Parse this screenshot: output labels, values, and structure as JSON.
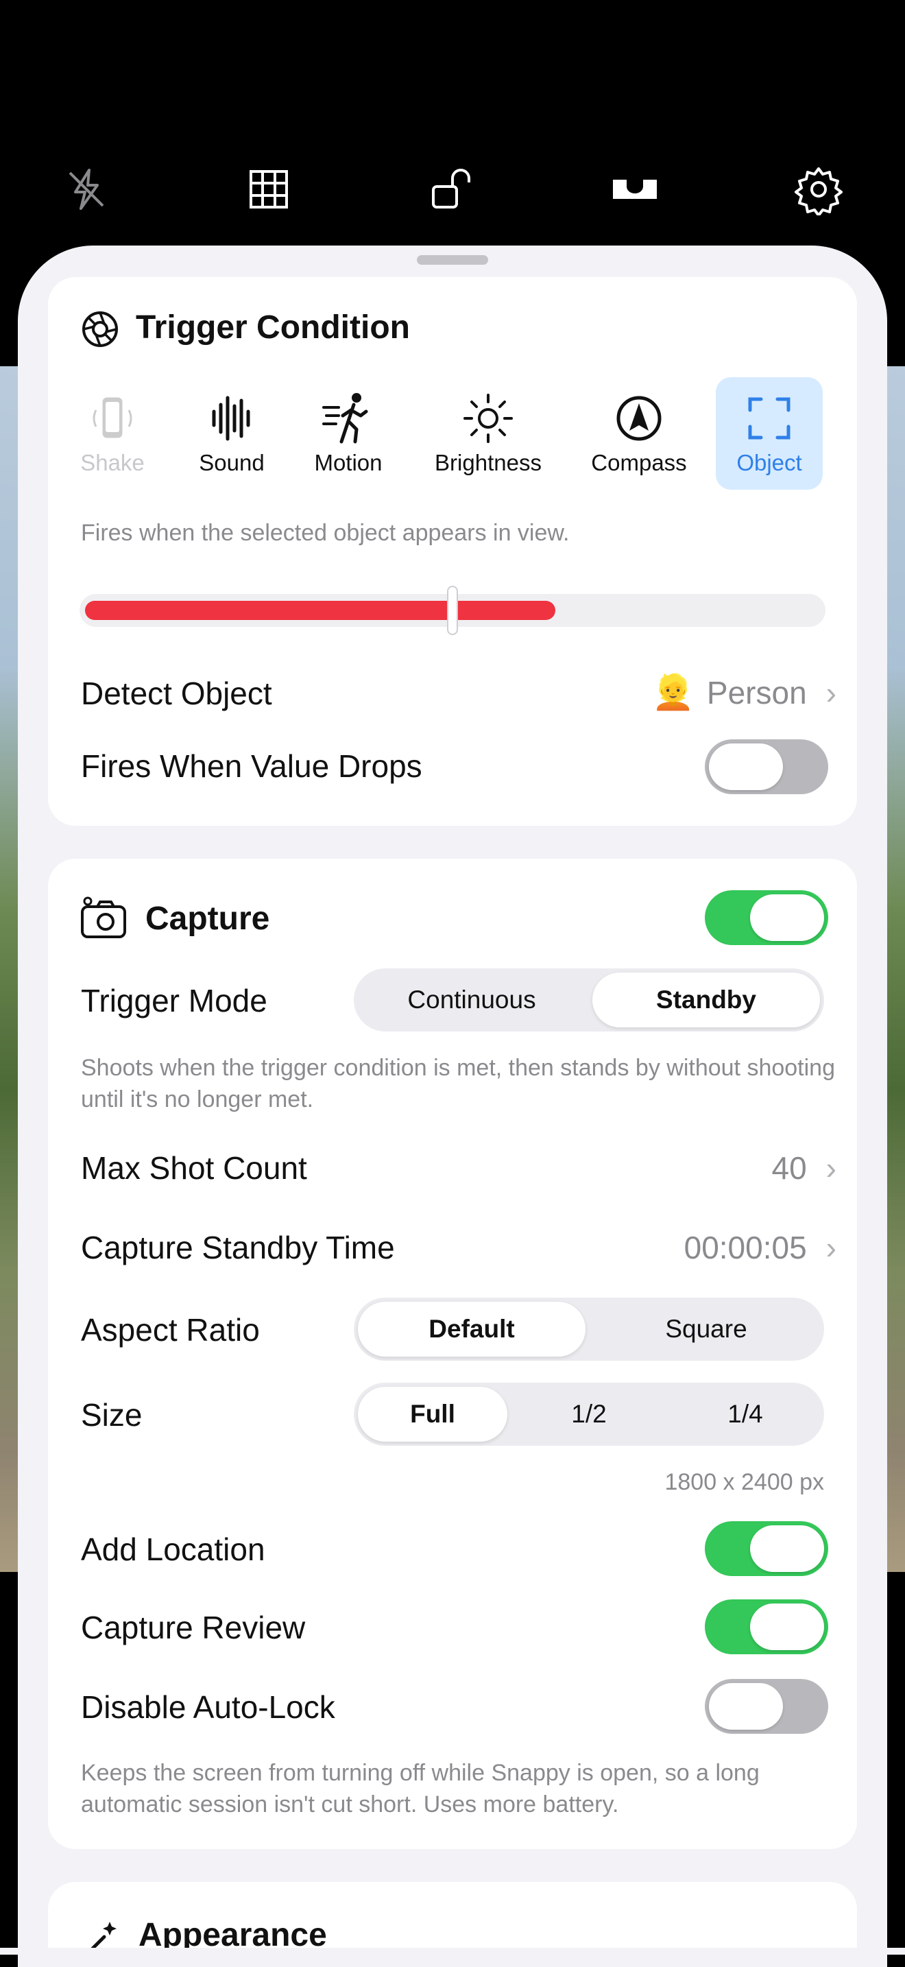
{
  "toolbar": {
    "icons": [
      "flash-off-icon",
      "grid-icon",
      "lock-open-icon",
      "level-icon",
      "gear-icon"
    ]
  },
  "trigger_condition": {
    "title": "Trigger Condition",
    "icon": "aperture-icon",
    "options": [
      {
        "label": "Shake",
        "icon": "phone-shake-icon"
      },
      {
        "label": "Sound",
        "icon": "waveform-icon"
      },
      {
        "label": "Motion",
        "icon": "running-figure-icon"
      },
      {
        "label": "Brightness",
        "icon": "sun-icon"
      },
      {
        "label": "Compass",
        "icon": "compass-icon"
      },
      {
        "label": "Object",
        "icon": "viewfinder-icon"
      }
    ],
    "selected": "Object",
    "description": "Fires when the selected object appears in view.",
    "slider": {
      "fill_fraction": 0.64,
      "thumb_fraction": 0.5
    },
    "detect_object": {
      "label": "Detect Object",
      "emoji": "👱",
      "value": "Person"
    },
    "fires_when_value_drops": {
      "label": "Fires When Value Drops",
      "on": false
    }
  },
  "capture": {
    "title": "Capture",
    "icon": "camera-timer-icon",
    "enabled": true,
    "trigger_mode": {
      "label": "Trigger Mode",
      "options": [
        "Continuous",
        "Standby"
      ],
      "selected": "Standby"
    },
    "trigger_mode_note": "Shoots when the trigger condition is met, then stands by without shooting until it's no longer met.",
    "max_shot_count": {
      "label": "Max Shot Count",
      "value": "40"
    },
    "capture_standby_time": {
      "label": "Capture Standby Time",
      "value": "00:00:05"
    },
    "aspect_ratio": {
      "label": "Aspect Ratio",
      "options": [
        "Default",
        "Square"
      ],
      "selected": "Default"
    },
    "size": {
      "label": "Size",
      "options": [
        "Full",
        "1/2",
        "1/4"
      ],
      "selected": "Full",
      "dimensions": "1800 x 2400 px"
    },
    "add_location": {
      "label": "Add Location",
      "on": true
    },
    "capture_review": {
      "label": "Capture Review",
      "on": true
    },
    "disable_auto_lock": {
      "label": "Disable Auto-Lock",
      "on": false
    },
    "disable_auto_lock_note": "Keeps the screen from turning off while Snappy is open, so a long automatic session isn't cut short. Uses more battery."
  },
  "appearance": {
    "title": "Appearance",
    "icon": "sparkle-wand-icon"
  },
  "colors": {
    "accent": "#2f80e8",
    "toggle_on": "#34c759",
    "slider": "#ef3340"
  }
}
